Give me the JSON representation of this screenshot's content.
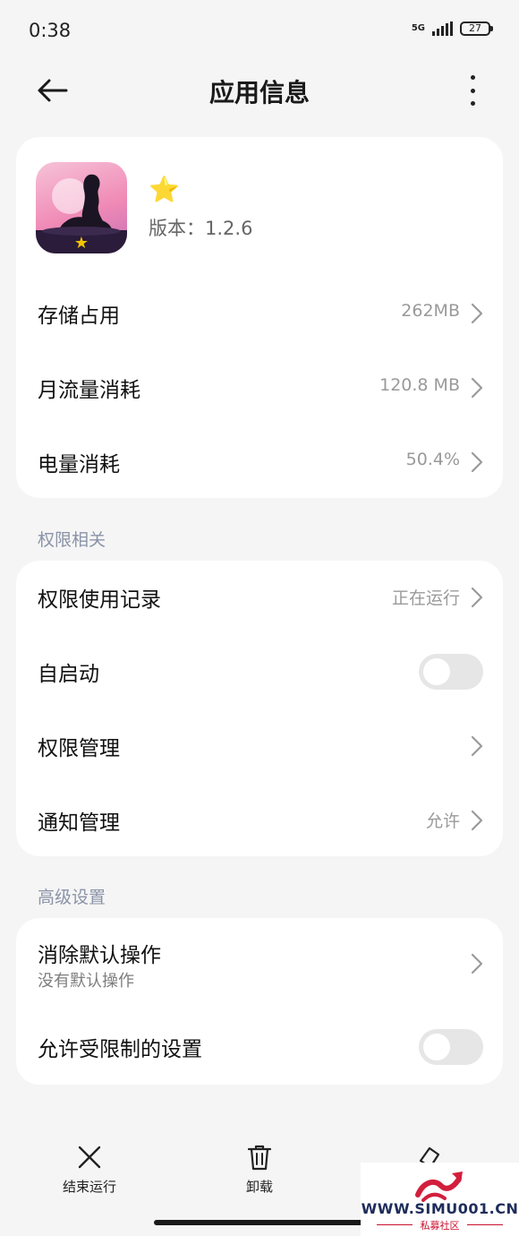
{
  "status_bar": {
    "time": "0:38",
    "network": "5G",
    "battery": "27"
  },
  "header": {
    "title": "应用信息"
  },
  "app": {
    "name_icon": "⭐",
    "version": "版本：1.2.6"
  },
  "usage": [
    {
      "label": "存储占用",
      "value": "262MB"
    },
    {
      "label": "月流量消耗",
      "value": "120.8 MB"
    },
    {
      "label": "电量消耗",
      "value": "50.4%"
    }
  ],
  "permissions": {
    "section_title": "权限相关",
    "usage_record": {
      "label": "权限使用记录",
      "value": "正在运行"
    },
    "autostart": {
      "label": "自启动",
      "enabled": false
    },
    "permission_management": {
      "label": "权限管理"
    },
    "notification_management": {
      "label": "通知管理",
      "value": "允许"
    }
  },
  "advanced": {
    "section_title": "高级设置",
    "clear_defaults": {
      "label": "消除默认操作",
      "sublabel": "没有默认操作"
    },
    "restricted_settings": {
      "label": "允许受限制的设置",
      "enabled": false
    }
  },
  "bottom_actions": {
    "force_stop": "结束运行",
    "uninstall": "卸载"
  },
  "watermark": {
    "text": "WWW.SIMU001.CN",
    "subtitle": "私募社区"
  },
  "colors": {
    "section_label": "#8a93a8",
    "secondary_text": "#9a9a9a",
    "card": "#ffffff",
    "background": "#f5f5f5"
  }
}
